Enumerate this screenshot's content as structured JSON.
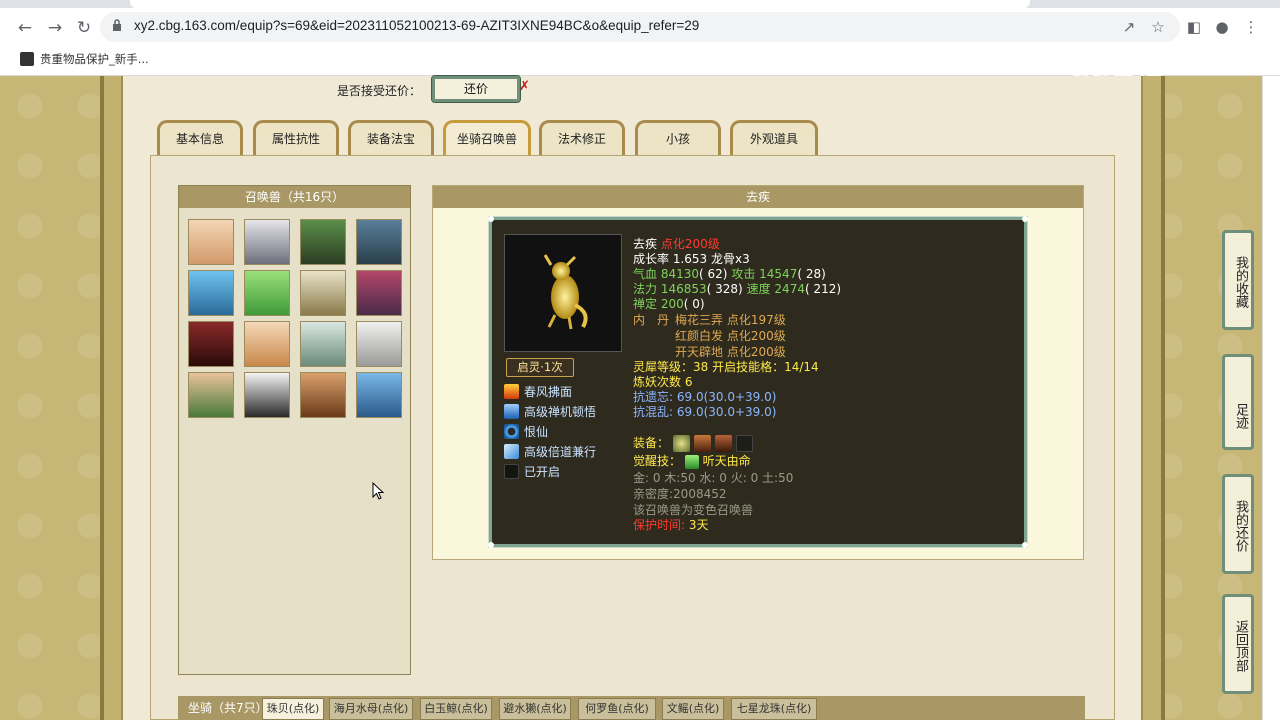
{
  "browser": {
    "url": "xy2.cbg.163.com/equip?s=69&eid=202311052100213-69-AZIT3IXNE94BC&o&equip_refer=29",
    "bookmark_label": "贵重物品保护_新手..."
  },
  "watermark": "CC直播",
  "offer": {
    "label": "是否接受还价：",
    "button": "还价"
  },
  "tabs": [
    {
      "label": "基本信息"
    },
    {
      "label": "属性抗性"
    },
    {
      "label": "装备法宝"
    },
    {
      "label": "坐骑召唤兽"
    },
    {
      "label": "法术修正"
    },
    {
      "label": "小孩"
    },
    {
      "label": "外观道具"
    }
  ],
  "pets_panel": {
    "title": "召唤兽（共16只）"
  },
  "detail": {
    "title": "去疾",
    "name": "去疾",
    "evolve": "点化200级",
    "growth": "成长率 1.653 龙骨x3",
    "hp_label": "气血",
    "hp_value": "84130",
    "hp_sub": "( 62)",
    "atk_label": "攻击",
    "atk_value": "14547",
    "atk_sub": "( 28)",
    "mp_label": "法力",
    "mp_value": "146853",
    "mp_sub": "( 328)",
    "spd_label": "速度",
    "spd_value": "2474",
    "spd_sub": "( 212)",
    "zen_label": "禅定",
    "zen_value": "200",
    "zen_sub": "( 0)",
    "neidan_label": "内　丹",
    "neidan": [
      "梅花三弄 点化197级",
      "红颜白发 点化200级",
      "开天辟地 点化200级"
    ],
    "lingxi": "灵犀等级：38 开启技能格：14/14",
    "lianyao": "炼妖次数 6",
    "resist1": "抗遗忘: 69.0(30.0+39.0)",
    "resist2": "抗混乱: 69.0(30.0+39.0)",
    "equip_label": "装备：",
    "awaken_label": "觉醒技：",
    "awaken_skill": "听天由命",
    "elements": "金: 0 木:50 水: 0 火: 0 土:50",
    "intimacy": "亲密度:2008452",
    "variant_note": "该召唤兽为变色召唤兽",
    "protect_label": "保护时间:",
    "protect_value": "3天",
    "qiling": "启灵·1次",
    "skills": [
      {
        "name": "春风拂面",
        "icon": "fire-icon"
      },
      {
        "name": "高级禅机顿悟",
        "icon": "wave-icon"
      },
      {
        "name": "恨仙",
        "icon": "ring-icon"
      },
      {
        "name": "高级倍道兼行",
        "icon": "wind-icon"
      },
      {
        "name": "已开启",
        "icon": "slot-icon"
      }
    ]
  },
  "mounts": {
    "label": "坐骑（共7只）",
    "tabs": [
      "珠贝(点化)",
      "海月水母(点化)",
      "白玉鲸(点化)",
      "避水獭(点化)",
      "何罗鱼(点化)",
      "文鳐(点化)",
      "七星龙珠(点化)"
    ]
  },
  "float_menu": {
    "favorites": "我的收藏",
    "footprint": "足迹",
    "my_offer": "我的还价",
    "top": "返回顶部"
  },
  "colors": {
    "accent_red": "#ff3b2f",
    "accent_green": "#7fd35a",
    "accent_yellow": "#ffe94a",
    "panel_header": "#a99866"
  }
}
